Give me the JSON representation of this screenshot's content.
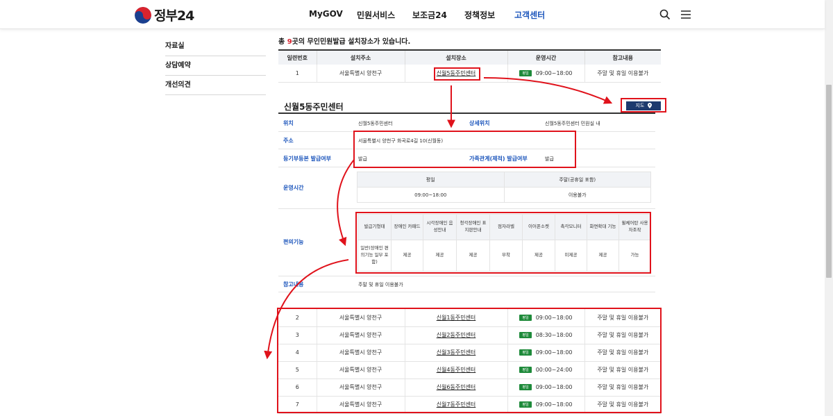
{
  "header": {
    "logo_text": "정부24",
    "nav": [
      "MyGOV",
      "민원서비스",
      "보조금24",
      "정책정보",
      "고객센터"
    ],
    "active_nav_index": 4
  },
  "sidebar": {
    "items": [
      {
        "label": "자료실"
      },
      {
        "label": "상담예약"
      },
      {
        "label": "개선의견"
      }
    ]
  },
  "summary": {
    "prefix": "총 ",
    "count": "9",
    "suffix": "곳의 무인민원발급 설치장소가 있습니다."
  },
  "list_table": {
    "headers": [
      "일련번호",
      "설치주소",
      "설치장소",
      "운영시간",
      "참고내용"
    ],
    "badge_label": "평일",
    "rows": [
      {
        "no": "1",
        "addr": "서울특별시 양천구",
        "place": "신월5동주민센터",
        "time": "09:00~18:00",
        "note": "주말 및 휴일 이용불가"
      },
      {
        "no": "2",
        "addr": "서울특별시 양천구",
        "place": "신월1동주민센터",
        "time": "09:00~18:00",
        "note": "주말 및 휴일 이용불가"
      },
      {
        "no": "3",
        "addr": "서울특별시 양천구",
        "place": "신월2동주민센터",
        "time": "08:30~18:00",
        "note": "주말 및 휴일 이용불가"
      },
      {
        "no": "4",
        "addr": "서울특별시 양천구",
        "place": "신월3동주민센터",
        "time": "09:00~18:00",
        "note": "주말 및 휴일 이용불가"
      },
      {
        "no": "5",
        "addr": "서울특별시 양천구",
        "place": "신월4동주민센터",
        "time": "00:00~24:00",
        "note": "주말 및 휴일 이용불가"
      },
      {
        "no": "6",
        "addr": "서울특별시 양천구",
        "place": "신월6동주민센터",
        "time": "09:00~18:00",
        "note": "주말 및 휴일 이용불가"
      },
      {
        "no": "7",
        "addr": "서울특별시 양천구",
        "place": "신월7동주민센터",
        "time": "09:00~18:00",
        "note": "주말 및 휴일 이용불가"
      }
    ]
  },
  "detail": {
    "title": "신월5동주민센터",
    "map_button": "지도",
    "location_label": "위치",
    "location_value": "신월5동주민센터",
    "detail_location_label": "상세위치",
    "detail_location_value": "신월5동주민센터 민원실 내",
    "address_label": "주소",
    "address_value": "서울특별시 양천구 화곡로4길 10(신월동)",
    "registry_label": "등기부등본 발급여부",
    "registry_value": "발급",
    "family_label": "가족관계(제적) 발급여부",
    "family_value": "발급",
    "hours_label": "운영시간",
    "hours_table": {
      "headers": [
        "평일",
        "주말(공휴일 포함)"
      ],
      "values": [
        "09:00~18:00",
        "이용불가"
      ]
    },
    "facility_label": "편의기능",
    "facility_table": {
      "headers": [
        "발급기형태",
        "장애인 카패드",
        "시각장애인 음성안내",
        "청각장애인 표지판안내",
        "점자라벨",
        "이어폰소켓",
        "촉각모니터",
        "화면확대 기능",
        "휠체어탄 사용자조작"
      ],
      "values": [
        "일반(장애인 편의기능 일부 포함)",
        "제공",
        "제공",
        "제공",
        "부착",
        "제공",
        "미제공",
        "제공",
        "가능"
      ]
    },
    "note_label": "참고내용",
    "note_value": "주말 및 휴일 이용불가"
  },
  "colors": {
    "accent": "#1d56bc",
    "annotation": "#e0121b",
    "badge": "#1e8a3a",
    "map_button": "#1d3a6e"
  },
  "icons": [
    "search-icon",
    "menu-icon",
    "location-pin-icon"
  ]
}
